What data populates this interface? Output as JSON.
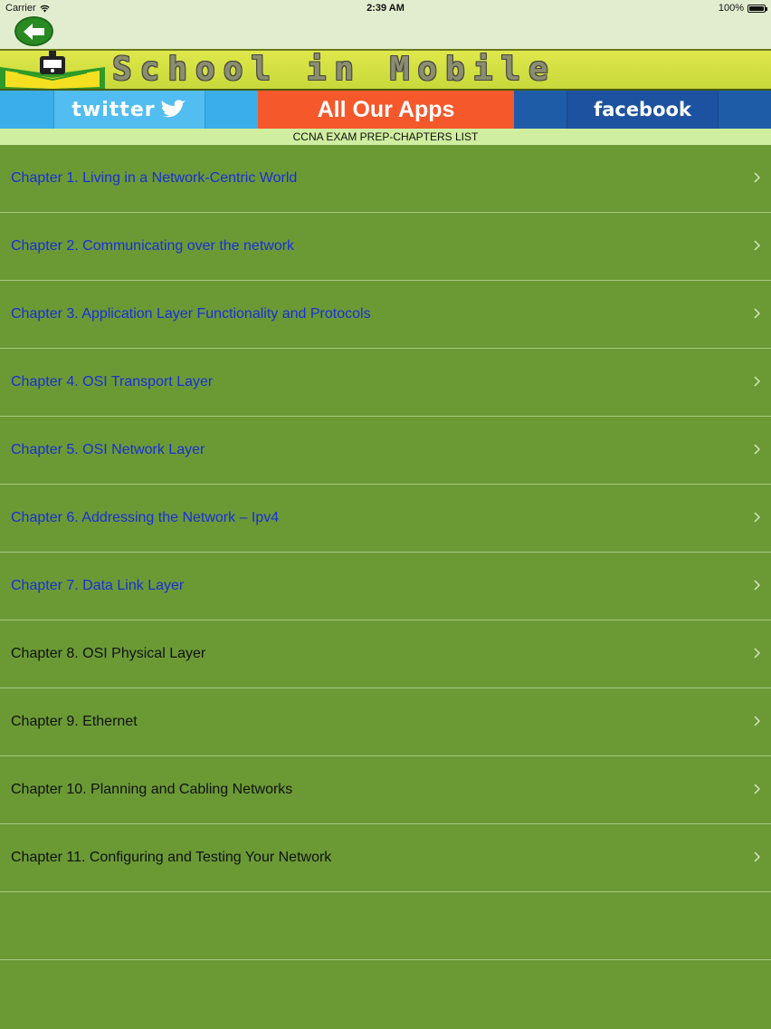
{
  "status_bar": {
    "carrier": "Carrier",
    "time": "2:39 AM",
    "battery": "100%"
  },
  "banner": {
    "title": "School in Mobile"
  },
  "social": {
    "twitter_label": "twitter",
    "all_apps_label": "All Our Apps",
    "facebook_label": "facebook"
  },
  "subtitle": "CCNA EXAM PREP-CHAPTERS LIST",
  "chapters": [
    {
      "label": "Chapter 1. Living in a Network-Centric World",
      "color": "#1a2ed8"
    },
    {
      "label": "Chapter 2. Communicating over the network",
      "color": "#1a2ed8"
    },
    {
      "label": "Chapter 3. Application Layer Functionality and Protocols",
      "color": "#1a2ed8"
    },
    {
      "label": "Chapter 4. OSI Transport Layer",
      "color": "#1a2ed8"
    },
    {
      "label": "Chapter 5. OSI Network Layer",
      "color": "#1a2ed8"
    },
    {
      "label": "Chapter 6. Addressing the Network – Ipv4",
      "color": "#1a2ed8"
    },
    {
      "label": "Chapter 7. Data Link Layer",
      "color": "#1a2ed8"
    },
    {
      "label": "Chapter 8. OSI Physical Layer",
      "color": "#111111"
    },
    {
      "label": "Chapter 9. Ethernet",
      "color": "#111111"
    },
    {
      "label": "Chapter 10. Planning and Cabling Networks",
      "color": "#111111"
    },
    {
      "label": "Chapter 11. Configuring and Testing Your Network",
      "color": "#111111"
    }
  ],
  "colors": {
    "list_background": "#6b9a35",
    "twitter": "#3aaee8",
    "all_apps": "#f5582b",
    "facebook": "#1f5ca8",
    "back_button": "#2a8a22"
  },
  "icons": {
    "back": "arrow-left-icon",
    "wifi": "wifi-icon",
    "battery": "battery-icon",
    "chevron": "chevron-right-icon",
    "twitter_bird": "twitter-bird-icon",
    "logo": "school-logo-icon"
  }
}
